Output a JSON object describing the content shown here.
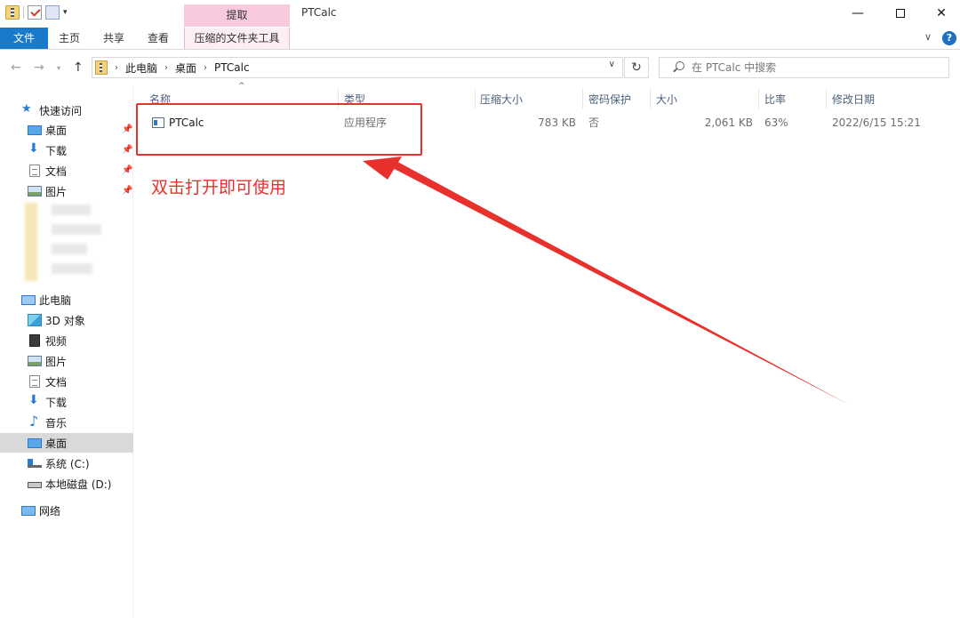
{
  "window": {
    "title": "PTCalc",
    "context_tab_group": "提取",
    "minimize": "—",
    "close": "✕"
  },
  "ribbon": {
    "tabs": [
      "文件",
      "主页",
      "共享",
      "查看",
      "压缩的文件夹工具"
    ],
    "expand": "∨",
    "help": "?"
  },
  "address": {
    "breadcrumbs": [
      "此电脑",
      "桌面",
      "PTCalc"
    ],
    "search_placeholder": "在 PTCalc 中搜索"
  },
  "nav": {
    "quick_access": "快速访问",
    "quick_items": [
      "桌面",
      "下载",
      "文档",
      "图片"
    ],
    "this_pc": "此电脑",
    "pc_items": [
      "3D 对象",
      "视频",
      "图片",
      "文档",
      "下载",
      "音乐",
      "桌面",
      "系统 (C:)",
      "本地磁盘 (D:)"
    ],
    "network": "网络"
  },
  "columns": [
    "名称",
    "类型",
    "压缩大小",
    "密码保护",
    "大小",
    "比率",
    "修改日期"
  ],
  "files": [
    {
      "name": "PTCalc",
      "type": "应用程序",
      "compressed_size": "783 KB",
      "password": "否",
      "size": "2,061 KB",
      "ratio": "63%",
      "modified": "2022/6/15 15:21"
    }
  ],
  "annotation": {
    "text": "双击打开即可使用",
    "color": "#e8312c"
  },
  "colors": {
    "accent": "#1979ca",
    "context_tab": "#f9c9de",
    "selected_nav": "#d9d9d9"
  }
}
